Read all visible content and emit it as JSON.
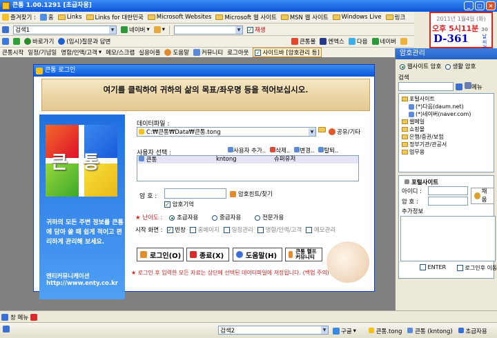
{
  "window": {
    "title": "큰통 1.00.1291 [초급자용]"
  },
  "favorites_bar": {
    "label": "즐겨찾기 :",
    "home": "홈",
    "links": [
      "Links",
      "Links for 대한민국",
      "Microsoft Websites",
      "Microsoft 웹 사이트",
      "MSN 웹 사이트",
      "Windows Live",
      "링크"
    ]
  },
  "search_bar": {
    "search_value": "검색1",
    "engine": "네이버",
    "url_value": "",
    "right_items": [
      "큰통몰",
      "엔엑스",
      "다음",
      "네이버"
    ],
    "record_label": "재생"
  },
  "nav_bar": {
    "go_label": "바로가기",
    "qa_label": "(임시)질문과 답변"
  },
  "menu_bar": {
    "items": [
      "큰통시작",
      "일정/기념일",
      "명함/인맥/고객",
      "메모/스크랩",
      "실용어플",
      "도움말",
      "커뮤니티",
      "로그아웃"
    ],
    "sidebar_toggle": "사이드바 [암호관리 등]"
  },
  "clock": {
    "date": "2011년 1월4일 (화)",
    "time": "오후 5시11분",
    "seconds": "30",
    "dday": "D-361",
    "weather": "날씨 검색"
  },
  "password_panel": {
    "title": "암호관리",
    "radio_site": "웹사이트 암호",
    "radio_life": "생활 암호",
    "search_label": "검색",
    "menu_label": "메뉴",
    "tree": [
      {
        "label": "포털사이트",
        "level": 0,
        "type": "folder"
      },
      {
        "label": "(*)다음(daum.net)",
        "level": 1,
        "type": "item"
      },
      {
        "label": "(*)네이버(naver.com)",
        "level": 1,
        "type": "item"
      },
      {
        "label": "웹메일",
        "level": 0,
        "type": "folder"
      },
      {
        "label": "쇼핑몰",
        "level": 0,
        "type": "folder"
      },
      {
        "label": "은행/증권/보험",
        "level": 0,
        "type": "folder"
      },
      {
        "label": "정부기관/관공서",
        "level": 0,
        "type": "folder"
      },
      {
        "label": "업무용",
        "level": 0,
        "type": "folder"
      }
    ],
    "portal_title": "포털사이트",
    "id_label": "아이디 :",
    "pw_label": "암   호 :",
    "extra_label": "추가정보",
    "submit_label": "채움",
    "enter_label": "ENTER",
    "after_login_label": "로그인후 이동"
  },
  "dialog": {
    "title": "큰통 로그인",
    "banner": "여기를 클릭하여 귀하의 삶의 목표/좌우명 등을 적어보십시오.",
    "logo_text": "큰통",
    "logo_desc": "귀하의 모든 주변 정보를 큰통에 담아 쓸 때 쉽게 적어고 편리하게 관리해 보세요.",
    "company": "엔티커뮤니케이션",
    "url": "http://www.enty.co.kr",
    "datafile_label": "데이터파일 :",
    "datafile_value": "C:₩큰통₩Data₩큰통.tong",
    "share_label": "공유/기타",
    "user_select_label": "사용자 선택 :",
    "add_user": "사용자 추가..",
    "delete_user": "삭제..",
    "change_user": "변경..",
    "withdraw_user": "탈퇴..",
    "users": [
      {
        "name": "큰통",
        "id": "kntong",
        "role": "슈퍼유저"
      }
    ],
    "password_label": "암    호 :",
    "password_value": "",
    "hint_label": "암호힌트/찾기",
    "remember_label": "암호기억",
    "remember_checked": true,
    "level_label": "난이도 :",
    "levels": [
      "초급자용",
      "중급자용",
      "전문가용"
    ],
    "level_selected": "초급자용",
    "start_screen_label": "시작 화면 :",
    "start_options": [
      {
        "label": "빈창",
        "checked": true
      },
      {
        "label": "홈페이지",
        "checked": false
      },
      {
        "label": "일정관리",
        "checked": false
      },
      {
        "label": "명함/인맥/고객",
        "checked": false
      },
      {
        "label": "메모관리",
        "checked": false
      }
    ],
    "login_button": "로그인(O)",
    "close_button": "종료(X)",
    "help_button": "도움말(H)",
    "help_community": "큰통 헬프 커뮤니티",
    "notice": "★ 로그인 후 입력한 모든 자료는 상단에 선택된 데이터파일에 저장됩니다. (백업 주의)"
  },
  "bottom": {
    "window_menu": "창 메뉴",
    "search2": "검색2",
    "engine2": "구글",
    "tasks": [
      "큰통.tong",
      "큰통 (kntong)",
      "초급자용"
    ]
  },
  "colors": {
    "titlebar": "#0a55d8",
    "accent_red": "#e02020",
    "dday_blue": "#0000cc"
  }
}
